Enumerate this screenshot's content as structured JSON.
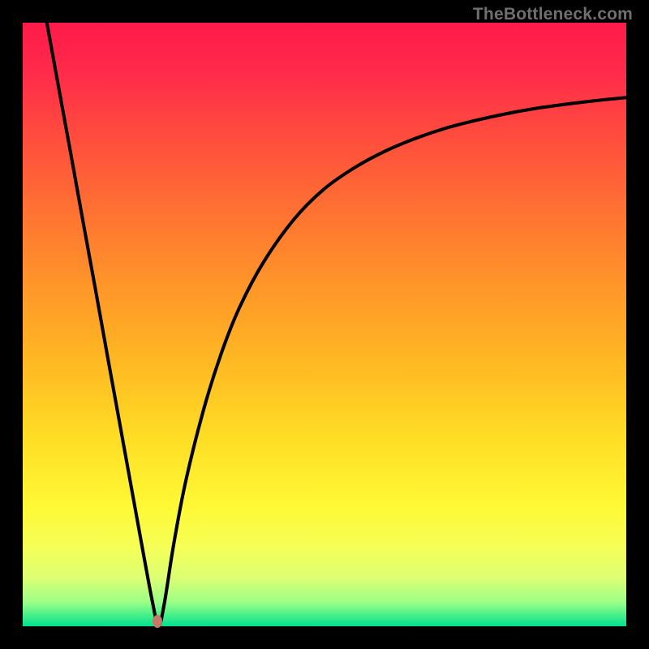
{
  "watermark": "TheBottleneck.com",
  "chart_data": {
    "type": "line",
    "title": "",
    "xlabel": "",
    "ylabel": "",
    "xlim": [
      0,
      100
    ],
    "ylim": [
      0,
      100
    ],
    "grid": false,
    "background_gradient": {
      "stops": [
        {
          "pos": 0.0,
          "color": "#ff1a4b"
        },
        {
          "pos": 0.08,
          "color": "#ff2a4a"
        },
        {
          "pos": 0.18,
          "color": "#ff4a3e"
        },
        {
          "pos": 0.3,
          "color": "#ff6e33"
        },
        {
          "pos": 0.42,
          "color": "#ff912a"
        },
        {
          "pos": 0.55,
          "color": "#ffb523"
        },
        {
          "pos": 0.68,
          "color": "#ffdb24"
        },
        {
          "pos": 0.8,
          "color": "#fff835"
        },
        {
          "pos": 0.87,
          "color": "#f5ff57"
        },
        {
          "pos": 0.92,
          "color": "#dcff73"
        },
        {
          "pos": 0.96,
          "color": "#9cff86"
        },
        {
          "pos": 1.0,
          "color": "#00e28e"
        }
      ]
    },
    "series": [
      {
        "name": "curve",
        "color": "#000000",
        "x": [
          4.0,
          6.0,
          8.0,
          10.0,
          12.0,
          14.0,
          16.0,
          18.0,
          20.0,
          21.5,
          22.5,
          23.5,
          25.0,
          27.0,
          30.0,
          33.0,
          36.0,
          40.0,
          45.0,
          50.0,
          55.0,
          60.0,
          65.0,
          70.0,
          75.0,
          80.0,
          85.0,
          90.0,
          95.0,
          100.0
        ],
        "values": [
          100,
          89.0,
          78.1,
          67.0,
          56.1,
          45.0,
          34.0,
          23.0,
          12.0,
          4.0,
          0.0,
          4.0,
          13.5,
          24.0,
          36.0,
          45.5,
          53.0,
          60.5,
          67.5,
          72.5,
          76.0,
          78.7,
          80.8,
          82.5,
          83.8,
          84.9,
          85.8,
          86.5,
          87.1,
          87.6
        ]
      }
    ],
    "marker": {
      "x": 22.3,
      "y": 0.8,
      "color": "#c37a66"
    }
  }
}
